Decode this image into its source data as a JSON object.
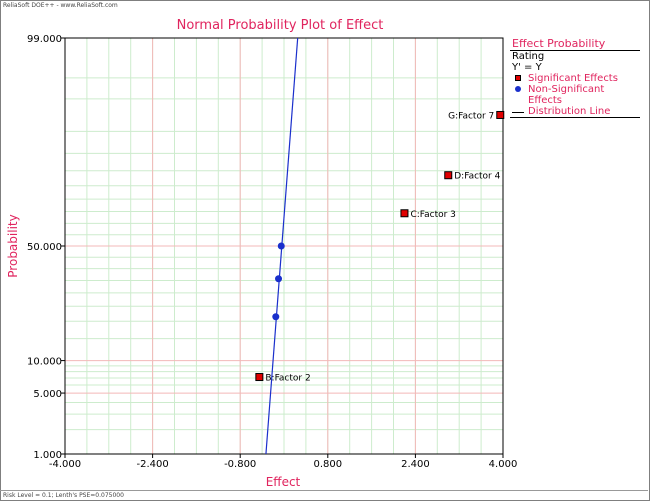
{
  "header": {
    "app_text": "ReliaSoft DOE++ - www.ReliaSoft.com"
  },
  "footer": {
    "status_text": "Risk Level = 0.1; Lenth's PSE=0.075000"
  },
  "colors": {
    "title": "#e0245e",
    "major_grid": "#f3b8b8",
    "minor_grid": "#cdeccd",
    "significant": "#e00000",
    "non_significant": "#1a2fcc",
    "distribution_line": "#1a2fcc"
  },
  "legend": {
    "title": "Effect Probability",
    "rating_label": "Rating",
    "equation": "Y' = Y",
    "items": [
      {
        "label": "Significant Effects",
        "icon": "red-square-icon"
      },
      {
        "label": "Non-Significant Effects",
        "icon": "blue-dot-icon"
      },
      {
        "label": "Distribution Line",
        "icon": "line-icon"
      }
    ]
  },
  "chart_data": {
    "type": "scatter",
    "title": "Normal Probability Plot of Effect",
    "xlabel": "Effect",
    "ylabel": "Probability",
    "x_scale": "linear",
    "y_scale": "normal-probability",
    "xlim": [
      -4.0,
      4.0
    ],
    "ylim": [
      1.0,
      99.0
    ],
    "x_ticks": [
      -4.0,
      -2.4,
      -0.8,
      0.8,
      2.4,
      4.0
    ],
    "x_tick_labels": [
      "-4.000",
      "-2.400",
      "-0.800",
      "0.800",
      "2.400",
      "4.000"
    ],
    "y_ticks": [
      1.0,
      5.0,
      10.0,
      50.0,
      99.0
    ],
    "y_tick_labels": [
      "1.000",
      "5.000",
      "10.000",
      "50.000",
      "99.000"
    ],
    "grid": true,
    "legend_position": "right",
    "series": [
      {
        "name": "Significant Effects",
        "points": [
          {
            "x": -0.45,
            "y": 7.14,
            "label": "B:Factor 2"
          },
          {
            "x": 2.2,
            "y": 64.29,
            "label": "C:Factor 3"
          },
          {
            "x": 3.0,
            "y": 78.57,
            "label": "D:Factor 4"
          },
          {
            "x": 3.95,
            "y": 92.86,
            "label": "G:Factor 7"
          }
        ]
      },
      {
        "name": "Non-Significant Effects",
        "points": [
          {
            "x": -0.05,
            "y": 50.0
          },
          {
            "x": -0.1,
            "y": 35.71
          },
          {
            "x": -0.15,
            "y": 21.43
          }
        ]
      },
      {
        "name": "Distribution Line",
        "line": [
          {
            "x": -0.33,
            "y": 1.0
          },
          {
            "x": 0.25,
            "y": 99.0
          }
        ]
      }
    ]
  }
}
